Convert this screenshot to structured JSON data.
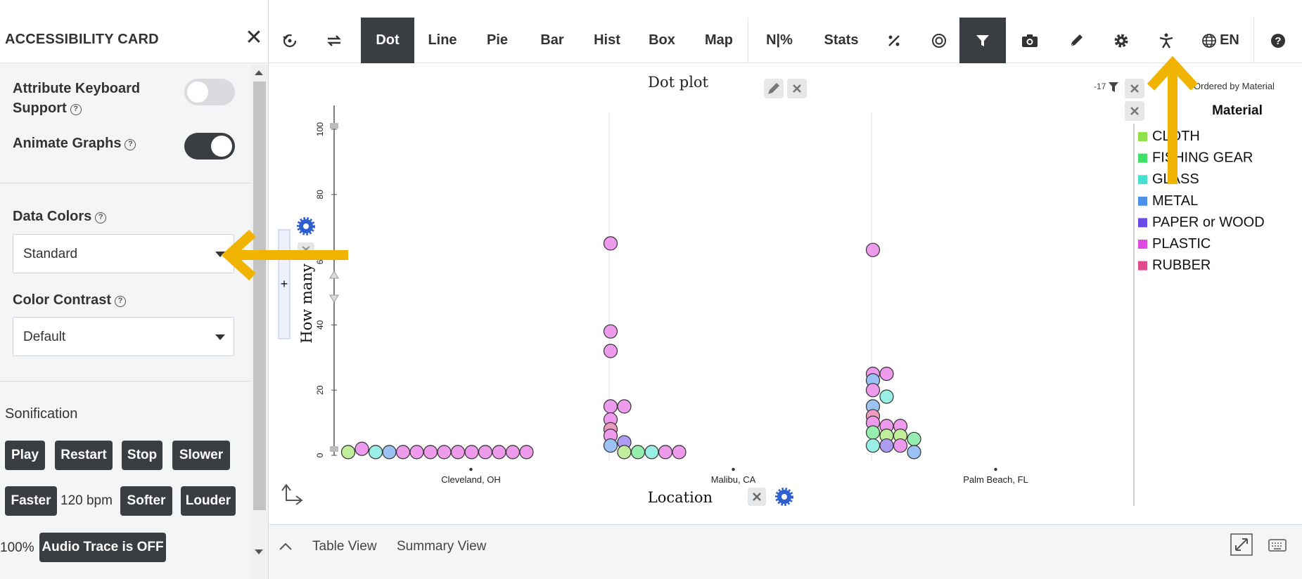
{
  "sidebar": {
    "title": "ACCESSIBILITY CARD",
    "close_icon": "close-icon",
    "keyboard_support": {
      "label_line1": "Attribute Keyboard",
      "label_line2": "Support",
      "enabled": false
    },
    "animate_graphs": {
      "label": "Animate Graphs",
      "enabled": true
    },
    "data_colors": {
      "label": "Data Colors",
      "value": "Standard"
    },
    "color_contrast": {
      "label": "Color Contrast",
      "value": "Default"
    },
    "sonification": {
      "heading": "Sonification",
      "play": "Play",
      "restart": "Restart",
      "stop": "Stop",
      "slower": "Slower",
      "faster": "Faster",
      "tempo": "120 bpm",
      "softer": "Softer",
      "louder": "Louder",
      "volume": "100%",
      "audio_trace": "Audio Trace is OFF"
    }
  },
  "toolbar": {
    "dot": "Dot",
    "line": "Line",
    "pie": "Pie",
    "bar": "Bar",
    "hist": "Hist",
    "box": "Box",
    "map": "Map",
    "n_percent": "N|%",
    "stats": "Stats",
    "language": "EN",
    "icons": [
      "reset-icon",
      "swap-icon",
      "percent-icon",
      "target-icon",
      "filter-icon",
      "camera-icon",
      "pen-icon",
      "gear-icon",
      "accessibility-icon",
      "globe-icon",
      "help-icon"
    ]
  },
  "graph": {
    "title": "Dot plot",
    "filter_count": "-17",
    "legend_order": "Ordered by Material",
    "legend_title": "Material",
    "legend_items": [
      {
        "label": "CLOTH",
        "color": "#8fe04a"
      },
      {
        "label": "FISHING GEAR",
        "color": "#3ee06a"
      },
      {
        "label": "GLASS",
        "color": "#45e0d0"
      },
      {
        "label": "METAL",
        "color": "#4a90e8"
      },
      {
        "label": "PAPER or WOOD",
        "color": "#6a4ae8"
      },
      {
        "label": "PLASTIC",
        "color": "#e04ae0"
      },
      {
        "label": "RUBBER",
        "color": "#e04a8a"
      }
    ],
    "x_axis_label": "Location",
    "y_axis_label": "How many",
    "add_button": "+"
  },
  "chart_data": {
    "type": "scatter",
    "xlabel": "Location",
    "ylabel": "How many",
    "ylim": [
      0,
      100
    ],
    "y_ticks": [
      "0",
      "20",
      "40",
      "60",
      "80",
      "100"
    ],
    "categories": [
      "Cleveland, OH",
      "Malibu, CA",
      "Palm Beach, FL"
    ],
    "series": [
      {
        "category": "Cleveland, OH",
        "points": [
          {
            "y": 1,
            "material": "CLOTH"
          },
          {
            "y": 2,
            "material": "PLASTIC"
          },
          {
            "y": 1,
            "material": "GLASS"
          },
          {
            "y": 1,
            "material": "METAL"
          },
          {
            "y": 1,
            "material": "PLASTIC"
          },
          {
            "y": 1,
            "material": "PLASTIC"
          },
          {
            "y": 1,
            "material": "PLASTIC"
          },
          {
            "y": 1,
            "material": "PLASTIC"
          },
          {
            "y": 1,
            "material": "PLASTIC"
          },
          {
            "y": 1,
            "material": "PLASTIC"
          },
          {
            "y": 1,
            "material": "PLASTIC"
          },
          {
            "y": 1,
            "material": "PLASTIC"
          },
          {
            "y": 1,
            "material": "PLASTIC"
          },
          {
            "y": 1,
            "material": "PLASTIC"
          }
        ]
      },
      {
        "category": "Malibu, CA",
        "points": [
          {
            "y": 65,
            "material": "PLASTIC"
          },
          {
            "y": 38,
            "material": "PLASTIC"
          },
          {
            "y": 32,
            "material": "PLASTIC"
          },
          {
            "y": 15,
            "material": "PLASTIC"
          },
          {
            "y": 15,
            "material": "PLASTIC"
          },
          {
            "y": 11,
            "material": "PLASTIC"
          },
          {
            "y": 8,
            "material": "RUBBER"
          },
          {
            "y": 6,
            "material": "PLASTIC"
          },
          {
            "y": 4,
            "material": "PAPER or WOOD"
          },
          {
            "y": 3,
            "material": "METAL"
          },
          {
            "y": 1,
            "material": "CLOTH"
          },
          {
            "y": 1,
            "material": "FISHING GEAR"
          },
          {
            "y": 1,
            "material": "GLASS"
          },
          {
            "y": 1,
            "material": "PLASTIC"
          },
          {
            "y": 1,
            "material": "PLASTIC"
          }
        ]
      },
      {
        "category": "Palm Beach, FL",
        "points": [
          {
            "y": 63,
            "material": "PLASTIC"
          },
          {
            "y": 25,
            "material": "PLASTIC"
          },
          {
            "y": 25,
            "material": "PLASTIC"
          },
          {
            "y": 23,
            "material": "METAL"
          },
          {
            "y": 20,
            "material": "PLASTIC"
          },
          {
            "y": 18,
            "material": "GLASS"
          },
          {
            "y": 15,
            "material": "METAL"
          },
          {
            "y": 12,
            "material": "RUBBER"
          },
          {
            "y": 10,
            "material": "PLASTIC"
          },
          {
            "y": 9,
            "material": "PLASTIC"
          },
          {
            "y": 9,
            "material": "PLASTIC"
          },
          {
            "y": 7,
            "material": "FISHING GEAR"
          },
          {
            "y": 6,
            "material": "CLOTH"
          },
          {
            "y": 6,
            "material": "CLOTH"
          },
          {
            "y": 5,
            "material": "FISHING GEAR"
          },
          {
            "y": 3,
            "material": "GLASS"
          },
          {
            "y": 3,
            "material": "PAPER or WOOD"
          },
          {
            "y": 3,
            "material": "PLASTIC"
          },
          {
            "y": 1,
            "material": "METAL"
          }
        ]
      }
    ]
  },
  "bottom_bar": {
    "table_view": "Table View",
    "summary_view": "Summary View"
  },
  "annotations": {
    "arrow_color": "#f0b400"
  }
}
